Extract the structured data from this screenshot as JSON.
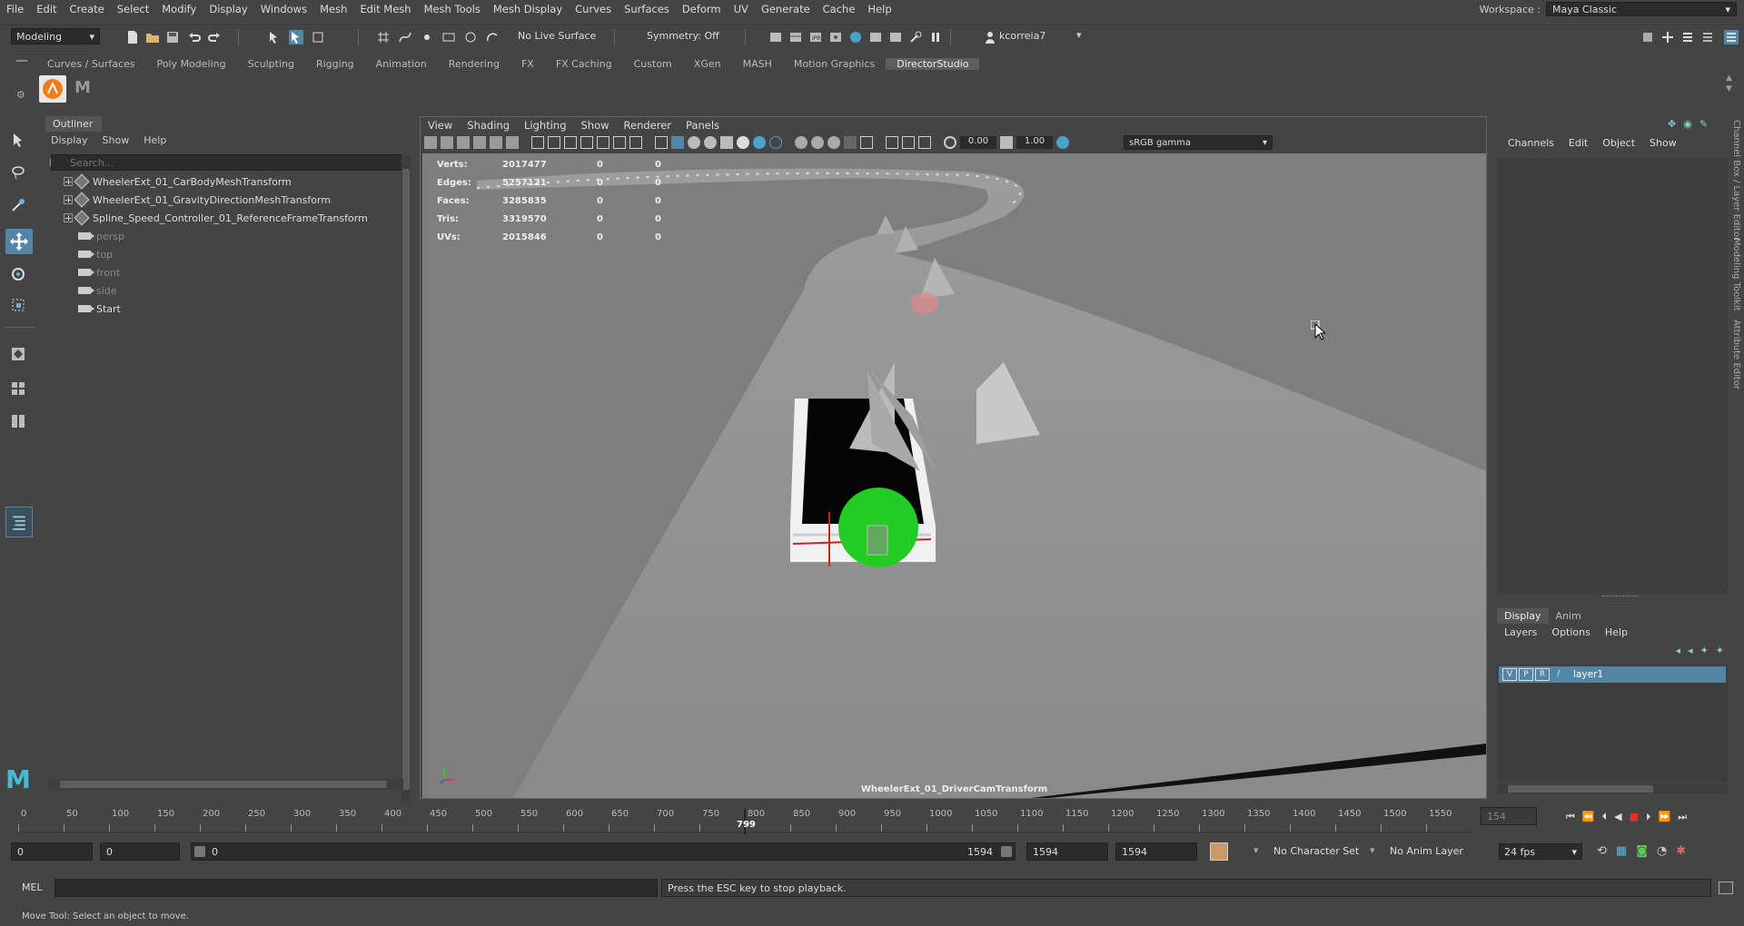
{
  "menubar": [
    "File",
    "Edit",
    "Create",
    "Select",
    "Modify",
    "Display",
    "Windows",
    "Mesh",
    "Edit Mesh",
    "Mesh Tools",
    "Mesh Display",
    "Curves",
    "Surfaces",
    "Deform",
    "UV",
    "Generate",
    "Cache",
    "Help"
  ],
  "workspace": {
    "label": "Workspace :",
    "value": "Maya Classic"
  },
  "statusline": {
    "mode": "Modeling",
    "live_surface": "No Live Surface",
    "symmetry": "Symmetry: Off",
    "user": "kcorreia7"
  },
  "shelf_tabs": [
    "Curves / Surfaces",
    "Poly Modeling",
    "Sculpting",
    "Rigging",
    "Animation",
    "Rendering",
    "FX",
    "FX Caching",
    "Custom",
    "XGen",
    "MASH",
    "Motion Graphics",
    "DirectorStudio"
  ],
  "shelf_active": "DirectorStudio",
  "outliner": {
    "title": "Outliner",
    "menus": [
      "Display",
      "Show",
      "Help"
    ],
    "search_placeholder": "Search...",
    "items": [
      {
        "name": "WheelerExt_01_CarBodyMeshTransform",
        "type": "mesh",
        "dim": false
      },
      {
        "name": "WheelerExt_01_GravityDirectionMeshTransform",
        "type": "mesh",
        "dim": false
      },
      {
        "name": "Spline_Speed_Controller_01_ReferenceFrameTransform",
        "type": "mesh",
        "dim": false
      },
      {
        "name": "persp",
        "type": "camera",
        "dim": true
      },
      {
        "name": "top",
        "type": "camera",
        "dim": true
      },
      {
        "name": "front",
        "type": "camera",
        "dim": true
      },
      {
        "name": "side",
        "type": "camera",
        "dim": true
      },
      {
        "name": "Start",
        "type": "camera",
        "dim": false
      }
    ]
  },
  "viewport": {
    "menus": [
      "View",
      "Shading",
      "Lighting",
      "Show",
      "Renderer",
      "Panels"
    ],
    "exposure": "0.00",
    "gamma": "1.00",
    "color_space": "sRGB gamma",
    "camera_label": "WheelerExt_01_DriverCamTransform",
    "hud": [
      {
        "label": "Verts:",
        "a": "2017477",
        "b": "0",
        "c": "0"
      },
      {
        "label": "Edges:",
        "a": "5257121",
        "b": "0",
        "c": "0"
      },
      {
        "label": "Faces:",
        "a": "3285835",
        "b": "0",
        "c": "0"
      },
      {
        "label": "Tris:",
        "a": "3319570",
        "b": "0",
        "c": "0"
      },
      {
        "label": "UVs:",
        "a": "2015846",
        "b": "0",
        "c": "0"
      }
    ]
  },
  "channelbox": {
    "menus": [
      "Channels",
      "Edit",
      "Object",
      "Show"
    ]
  },
  "layer_editor": {
    "tabs": [
      "Display",
      "Anim"
    ],
    "menus": [
      "Layers",
      "Options",
      "Help"
    ],
    "layer": {
      "v": "V",
      "p": "P",
      "r": "R",
      "name": "layer1"
    }
  },
  "side_tabs": [
    "Channel Box / Layer Editor",
    "Modeling Toolkit",
    "Attribute Editor"
  ],
  "timeline": {
    "ticks": [
      "0",
      "50",
      "100",
      "150",
      "200",
      "250",
      "300",
      "350",
      "400",
      "450",
      "500",
      "550",
      "600",
      "650",
      "700",
      "750",
      "800",
      "850",
      "900",
      "950",
      "1000",
      "1050",
      "1100",
      "1150",
      "1200",
      "1250",
      "1300",
      "1350",
      "1400",
      "1450",
      "1500",
      "1550"
    ],
    "current_frame": "799",
    "current_field": "154",
    "start": 0,
    "end": 1594
  },
  "range": {
    "start_time": "0",
    "start_playback": "0",
    "slider_start": "0",
    "slider_end": "1594",
    "end_playback": "1594",
    "end_time": "1594",
    "character_set": "No Character Set",
    "anim_layer": "No Anim Layer",
    "fps": "24 fps"
  },
  "cmdline": {
    "lang": "MEL",
    "result": "Press the ESC key to stop playback."
  },
  "helpline": "Move Tool: Select an object to move.",
  "colors": {
    "accent": "#5285a6",
    "viewport_bg": "#7e7e7e",
    "green": "#22cc22"
  }
}
